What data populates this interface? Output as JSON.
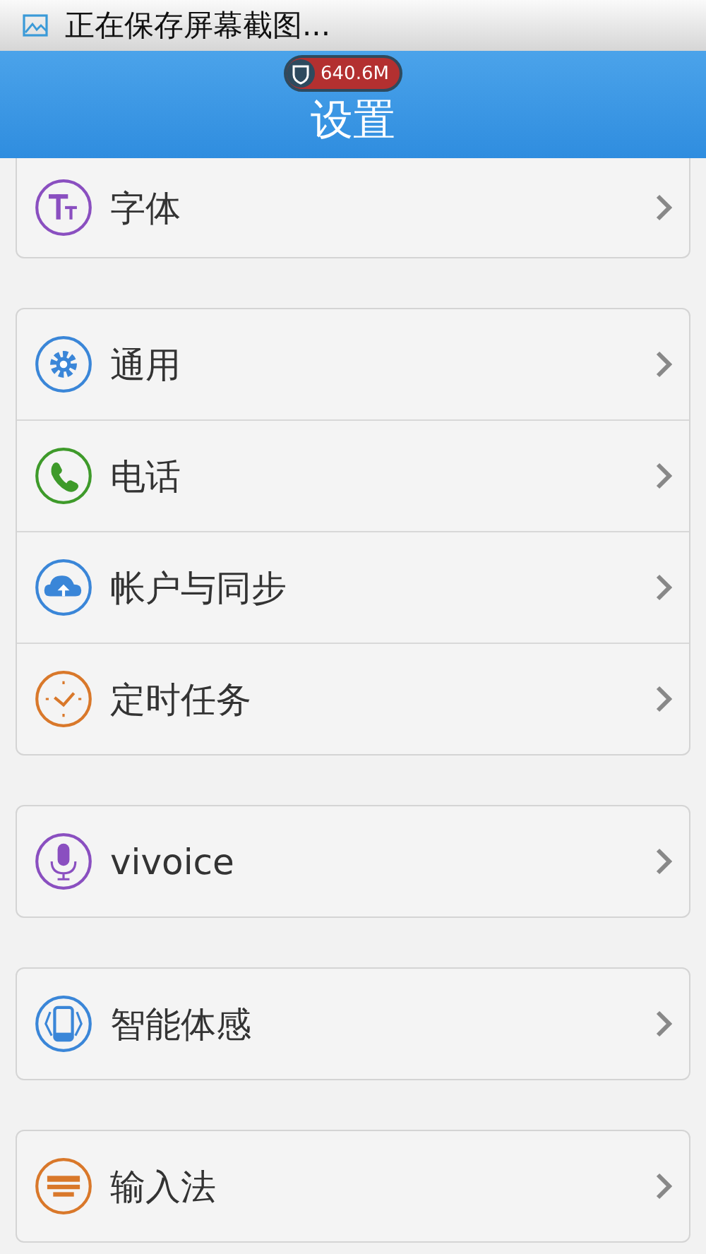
{
  "status_bar": {
    "notification": "正在保存屏幕截图..."
  },
  "header": {
    "title": "设置",
    "memory_badge": "640.6M"
  },
  "groups": [
    {
      "items": [
        {
          "label": "字体",
          "color": "#8a4fc0"
        }
      ]
    },
    {
      "items": [
        {
          "label": "通用",
          "color": "#3a86d8"
        },
        {
          "label": "电话",
          "color": "#3e9a2a"
        },
        {
          "label": "帐户与同步",
          "color": "#3a86d8"
        },
        {
          "label": "定时任务",
          "color": "#d9782a"
        }
      ]
    },
    {
      "items": [
        {
          "label": "vivoice",
          "color": "#8a4fc0"
        }
      ]
    },
    {
      "items": [
        {
          "label": "智能体感",
          "color": "#3a86d8"
        }
      ]
    },
    {
      "items": [
        {
          "label": "输入法",
          "color": "#d9782a"
        }
      ]
    }
  ]
}
